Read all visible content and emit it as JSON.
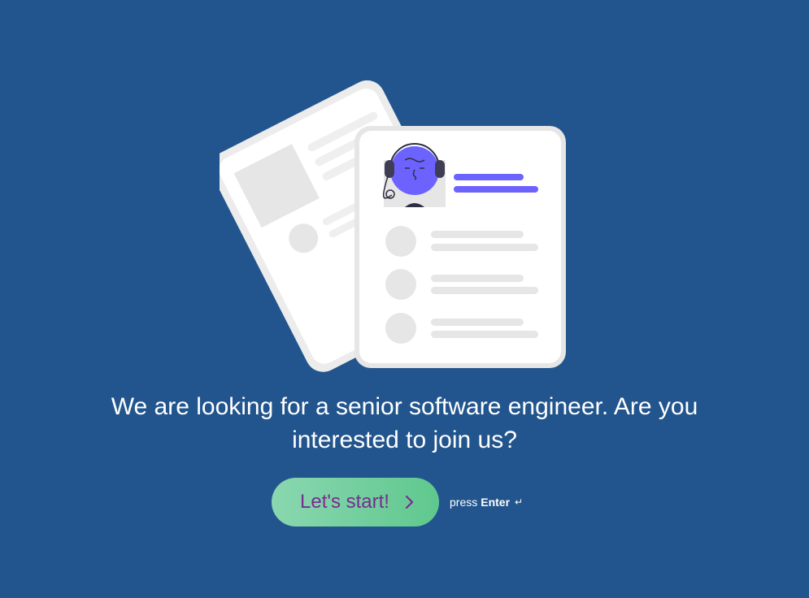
{
  "page": {
    "background": "#22558d"
  },
  "illustration": {
    "accent": "#6c63ff",
    "paper": "#ffffff",
    "placeholder": "#e6e6e6"
  },
  "question": {
    "text": "We are looking for a senior software engineer. Are you interested to join us?"
  },
  "start": {
    "label": "Let's start!",
    "icon": "chevron-right-icon",
    "text_color": "#7a2b8f"
  },
  "hint": {
    "prefix": "press",
    "key": "Enter",
    "icon": "enter-key-icon",
    "glyph": "↵"
  }
}
